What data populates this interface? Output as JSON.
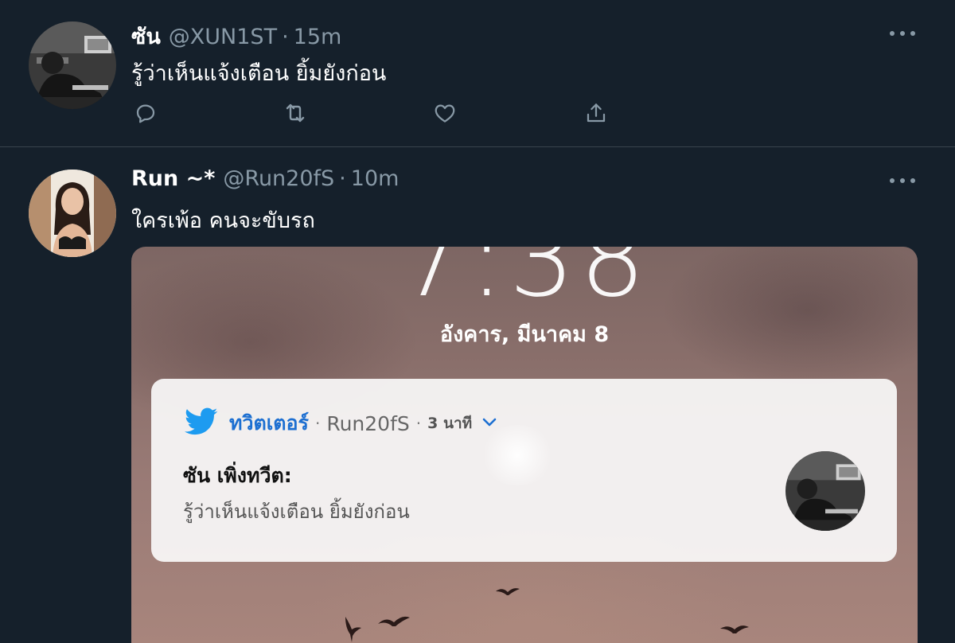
{
  "tweets": [
    {
      "name": "ซัน",
      "handle": "@XUN1ST",
      "separator": "·",
      "time": "15m",
      "text": "รู้ว่าเห็นแจ้งเตือน ยิ้มยังก่อน",
      "avatar": "user-avatar-photo-grayscale",
      "actions": [
        "reply-icon",
        "retweet-icon",
        "like-icon",
        "share-icon"
      ]
    },
    {
      "name": "Run ~*",
      "handle": "@Run20fS",
      "separator": "·",
      "time": "10m",
      "text": "ใครเพ้อ คนจะขับรถ",
      "avatar": "user-avatar-photo-color",
      "media": {
        "clock": "7:38",
        "lock_date": "อังคาร, มีนาคม 8",
        "notification": {
          "app_icon": "twitter-bird-icon",
          "app_name": "ทวิตเตอร์",
          "separator": "·",
          "account": "Run20fS",
          "time": "3 นาที",
          "title": "ซัน เพิ่งทวีต:",
          "body": "รู้ว่าเห็นแจ้งเตือน ยิ้มยังก่อน"
        }
      }
    }
  ],
  "colors": {
    "background": "#15202b",
    "secondary_text": "#8899a6",
    "divider": "#38444d",
    "twitter_blue": "#1d9bf0",
    "notif_app_blue": "#1d6fd1"
  }
}
